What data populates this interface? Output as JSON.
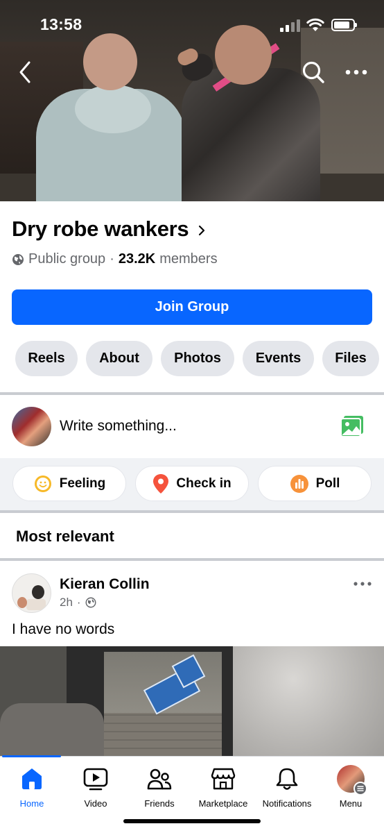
{
  "status_bar": {
    "time": "13:58"
  },
  "icons": {
    "back": "chevron-left-icon",
    "search": "search-icon",
    "more": "ellipsis-icon",
    "globe": "globe-icon",
    "photo": "photo-icon",
    "feeling": "smile-icon",
    "checkin": "location-pin-icon",
    "poll": "poll-icon"
  },
  "colors": {
    "accent": "#0866ff",
    "feeling": "#f7b928",
    "checkin": "#f5533d",
    "poll": "#f7923a",
    "photo": "#45bd62"
  },
  "group": {
    "name": "Dry robe wankers",
    "privacy": "Public group",
    "separator": "·",
    "member_count": "23.2K",
    "member_label": "members",
    "join_label": "Join Group"
  },
  "tabs": [
    "Reels",
    "About",
    "Photos",
    "Events",
    "Files"
  ],
  "composer": {
    "placeholder": "Write something...",
    "actions": [
      {
        "label": "Feeling",
        "icon": "smile-icon"
      },
      {
        "label": "Check in",
        "icon": "location-pin-icon"
      },
      {
        "label": "Poll",
        "icon": "poll-icon"
      }
    ]
  },
  "feed": {
    "sort_label": "Most relevant",
    "post": {
      "author": "Kieran Collin",
      "time": "2h",
      "dot": "·",
      "text": "I have no words"
    }
  },
  "bottom_nav": [
    {
      "label": "Home",
      "icon": "home-icon",
      "active": true
    },
    {
      "label": "Video",
      "icon": "video-icon",
      "active": false
    },
    {
      "label": "Friends",
      "icon": "friends-icon",
      "active": false
    },
    {
      "label": "Marketplace",
      "icon": "marketplace-icon",
      "active": false
    },
    {
      "label": "Notifications",
      "icon": "bell-icon",
      "active": false
    },
    {
      "label": "Menu",
      "icon": "profile-avatar",
      "active": false
    }
  ]
}
